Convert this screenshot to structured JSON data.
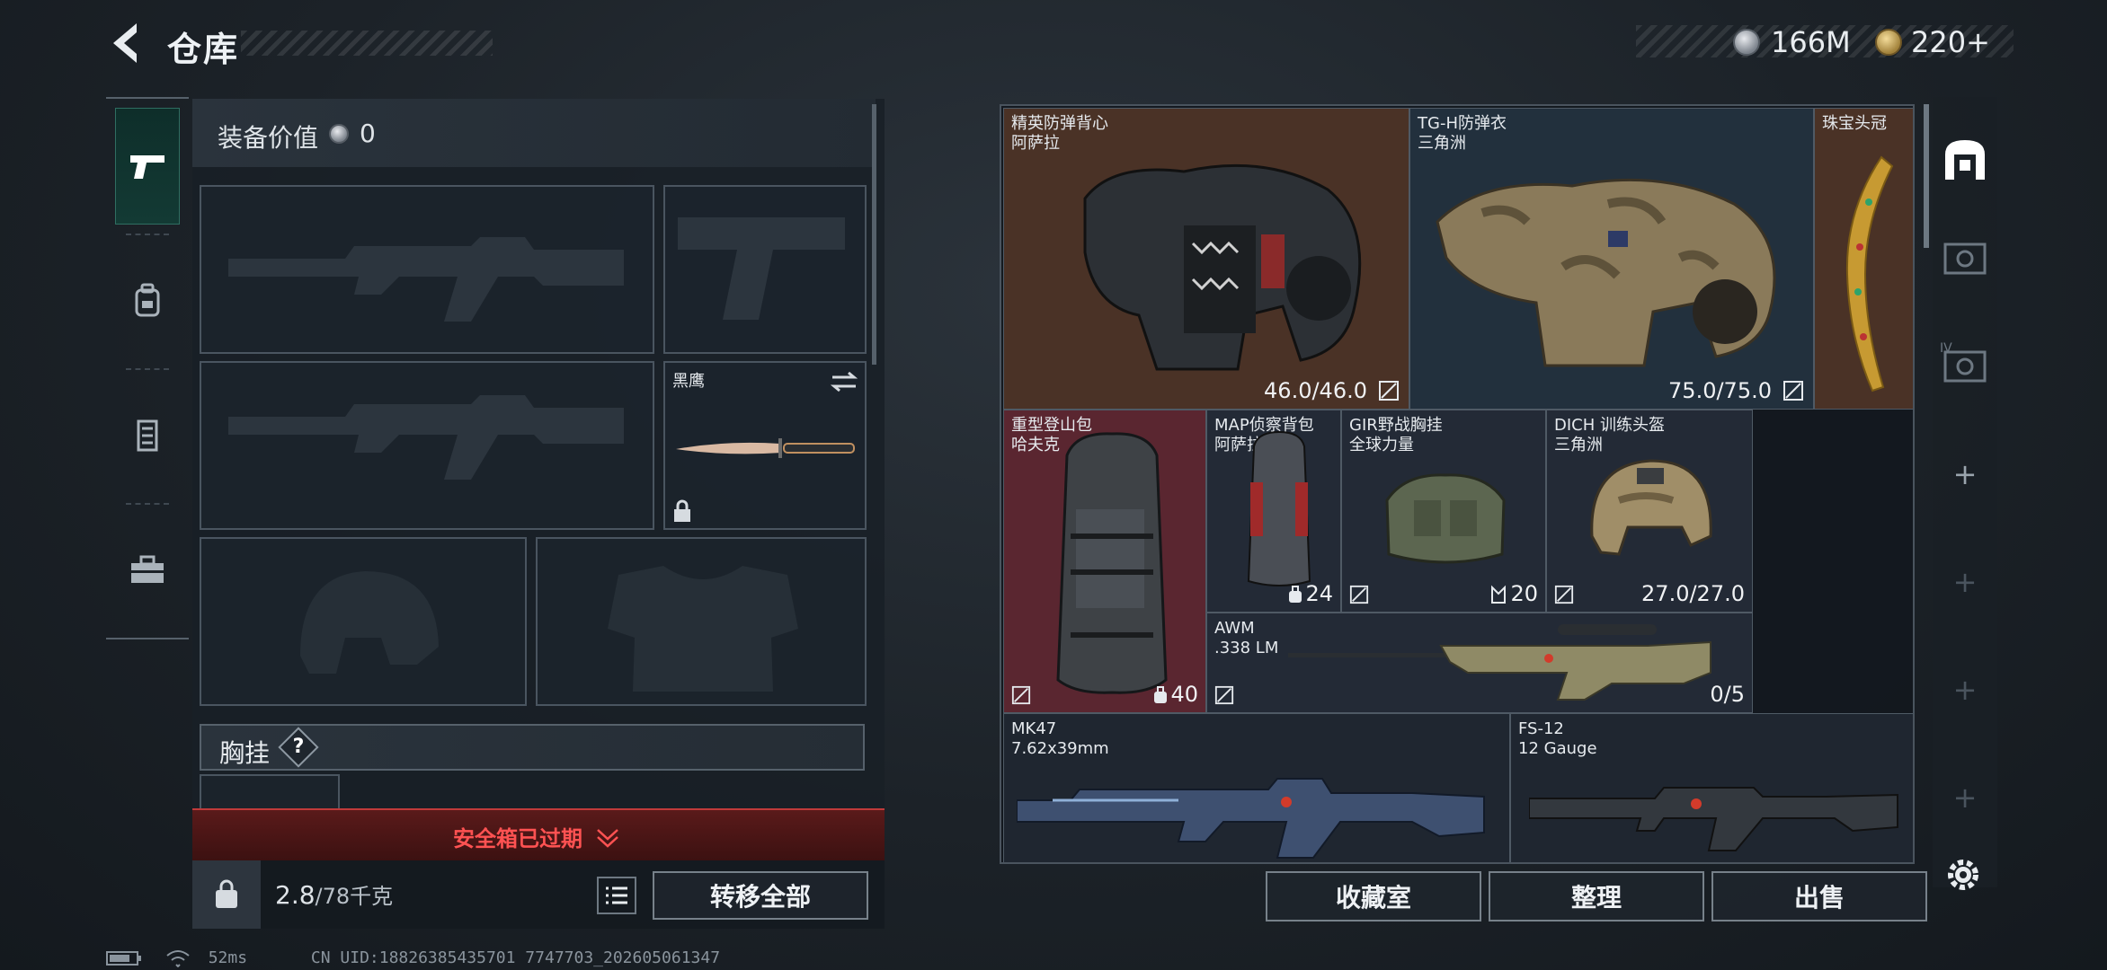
{
  "header": {
    "title": "仓库",
    "currency_silver": "166M",
    "currency_gold": "220+"
  },
  "loadout": {
    "value_label": "装备价值",
    "value_num": "0",
    "melee_name": "黑鹰",
    "chest_label": "胸挂",
    "chest_help": "?",
    "safebox_label": "安全箱已过期",
    "weight_main": "2.8",
    "weight_max": "/78千克",
    "transfer_all": "转移全部"
  },
  "storage": {
    "items": [
      {
        "name": "精英防弹背心",
        "sub": "阿萨拉",
        "stat": "46.0/46.0"
      },
      {
        "name": "TG-H防弹衣",
        "sub": "三角洲",
        "stat": "75.0/75.0"
      },
      {
        "name": "珠宝头冠",
        "sub": "",
        "stat": ""
      },
      {
        "name": "重型登山包",
        "sub": "哈夫克",
        "stat": "40"
      },
      {
        "name": "MAP侦察背包",
        "sub": "阿萨拉",
        "stat": "24"
      },
      {
        "name": "GIR野战胸挂",
        "sub": "全球力量",
        "stat": "20"
      },
      {
        "name": "DICH 训练头盔",
        "sub": "三角洲",
        "stat": "27.0/27.0"
      },
      {
        "name": "AWM",
        "sub": ".338 LM",
        "stat": "0/5"
      },
      {
        "name": "MK47",
        "sub": "7.62x39mm",
        "stat": ""
      },
      {
        "name": "FS-12",
        "sub": "12 Gauge",
        "stat": ""
      }
    ],
    "buttons": {
      "collection": "收藏室",
      "organize": "整理",
      "sell": "出售"
    }
  },
  "rail": {
    "labels": [
      "",
      "",
      "IV",
      "+",
      "+",
      "+",
      "+"
    ]
  },
  "status": {
    "ping": "52ms",
    "uid": "CN UID:18826385435701 7747703_202605061347"
  },
  "colors": {
    "accent": "#3fd8b0",
    "danger": "#ff5252",
    "rare_brown": "#4a3226",
    "rare_red": "#5a2630",
    "rare_blue": "#22303d"
  }
}
